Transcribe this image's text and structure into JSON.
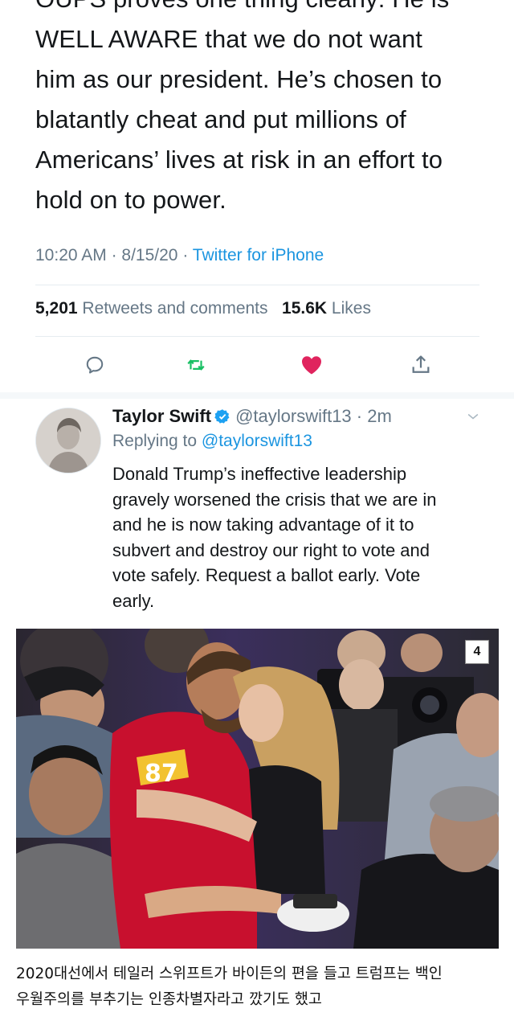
{
  "main_tweet": {
    "lines": [
      "OUPS proves one thing clearly: He is",
      "WELL AWARE that we do not want",
      "him as our president. He’s chosen to",
      "blatantly cheat and put millions of",
      "Americans’ lives at risk in an effort to",
      "hold on to power."
    ],
    "time": "10:20 AM",
    "date": "8/15/20",
    "client": "Twitter for iPhone",
    "retweets_count": "5,201",
    "retweets_label": "Retweets and comments",
    "likes_count": "15.6K",
    "likes_label": "Likes"
  },
  "reply_tweet": {
    "name": "Taylor Swift",
    "handle": "@taylorswift13",
    "time_ago": "2m",
    "replying_prefix": "Replying to",
    "replying_to": "@taylorswift13",
    "lines": [
      "Donald Trump’s ineffective leadership",
      "gravely worsened the crisis that we are in",
      "and he is now taking advantage of it to",
      "subvert and destroy our right to vote and",
      "vote safely. Request a ballot early. Vote",
      "early."
    ]
  },
  "photo": {
    "badge": "4",
    "jersey_number": "87"
  },
  "caption": {
    "lines": [
      "2020대선에서 테일러 스위프트가 바이든의 편을 들고 트럼프는 백인",
      "우월주의를 부추기는 인종차별자라고 깠기도 했고"
    ]
  },
  "colors": {
    "link": "#1b95e0",
    "like": "#e0245e",
    "retweet": "#17bf63",
    "muted": "#657786"
  },
  "icons": [
    "reply-icon",
    "retweet-icon",
    "like-icon",
    "share-icon",
    "verified-icon",
    "chevron-down-icon"
  ]
}
